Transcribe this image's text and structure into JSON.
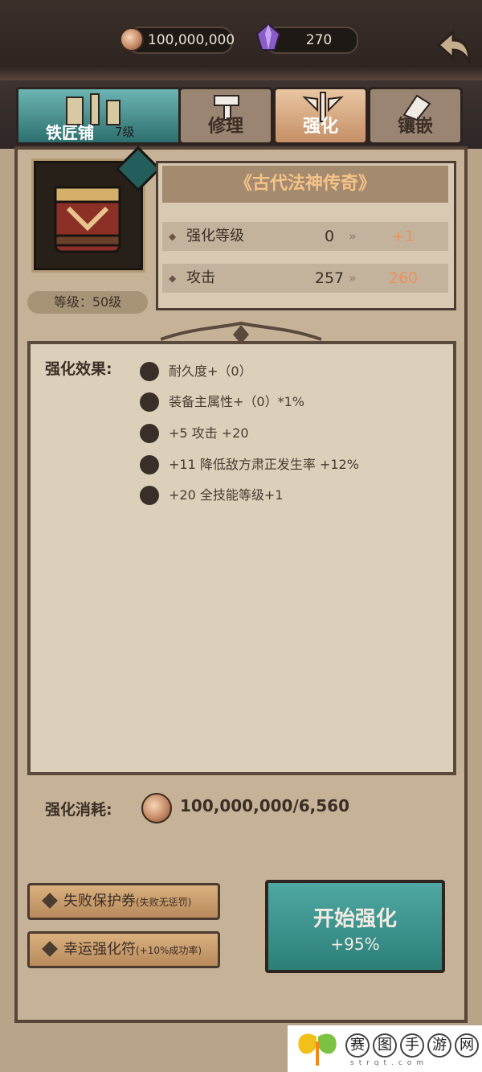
{
  "currency": {
    "coins": "100,000,000",
    "gems": "270"
  },
  "shop": {
    "name": "铁匠铺",
    "level": "7级"
  },
  "tabs": [
    {
      "label": "修理",
      "icon": "hammer-icon",
      "active": false
    },
    {
      "label": "强化",
      "icon": "sword-wings-icon",
      "active": true
    },
    {
      "label": "镶嵌",
      "icon": "gem-hammer-icon",
      "active": false
    }
  ],
  "item": {
    "level_label": "等级：50级",
    "name": "《古代法神传奇》",
    "stats": [
      {
        "name": "强化等级",
        "current": "0",
        "next": "+1"
      },
      {
        "name": "攻击",
        "current": "257",
        "next": "260"
      }
    ]
  },
  "effects": {
    "label": "强化效果:",
    "items": [
      "耐久度+（0）",
      "装备主属性+（0）*1%",
      "+5  攻击 +20",
      "+11  降低敌方肃正发生率 +12%",
      "+20  全技能等级+1"
    ]
  },
  "cost": {
    "label": "强化消耗:",
    "value": "100,000,000/6,560"
  },
  "options": [
    {
      "label": "失败保护券",
      "sub": "(失败无惩罚)"
    },
    {
      "label": "幸运强化符",
      "sub": "(+10%成功率)"
    }
  ],
  "start": {
    "label": "开始强化",
    "rate": "+95%"
  },
  "watermark": {
    "chars": [
      "赛",
      "图",
      "手",
      "游",
      "网"
    ],
    "url": "strqt.com"
  },
  "colors": {
    "accent_orange": "#e8925a",
    "teal": "#3a918c"
  }
}
